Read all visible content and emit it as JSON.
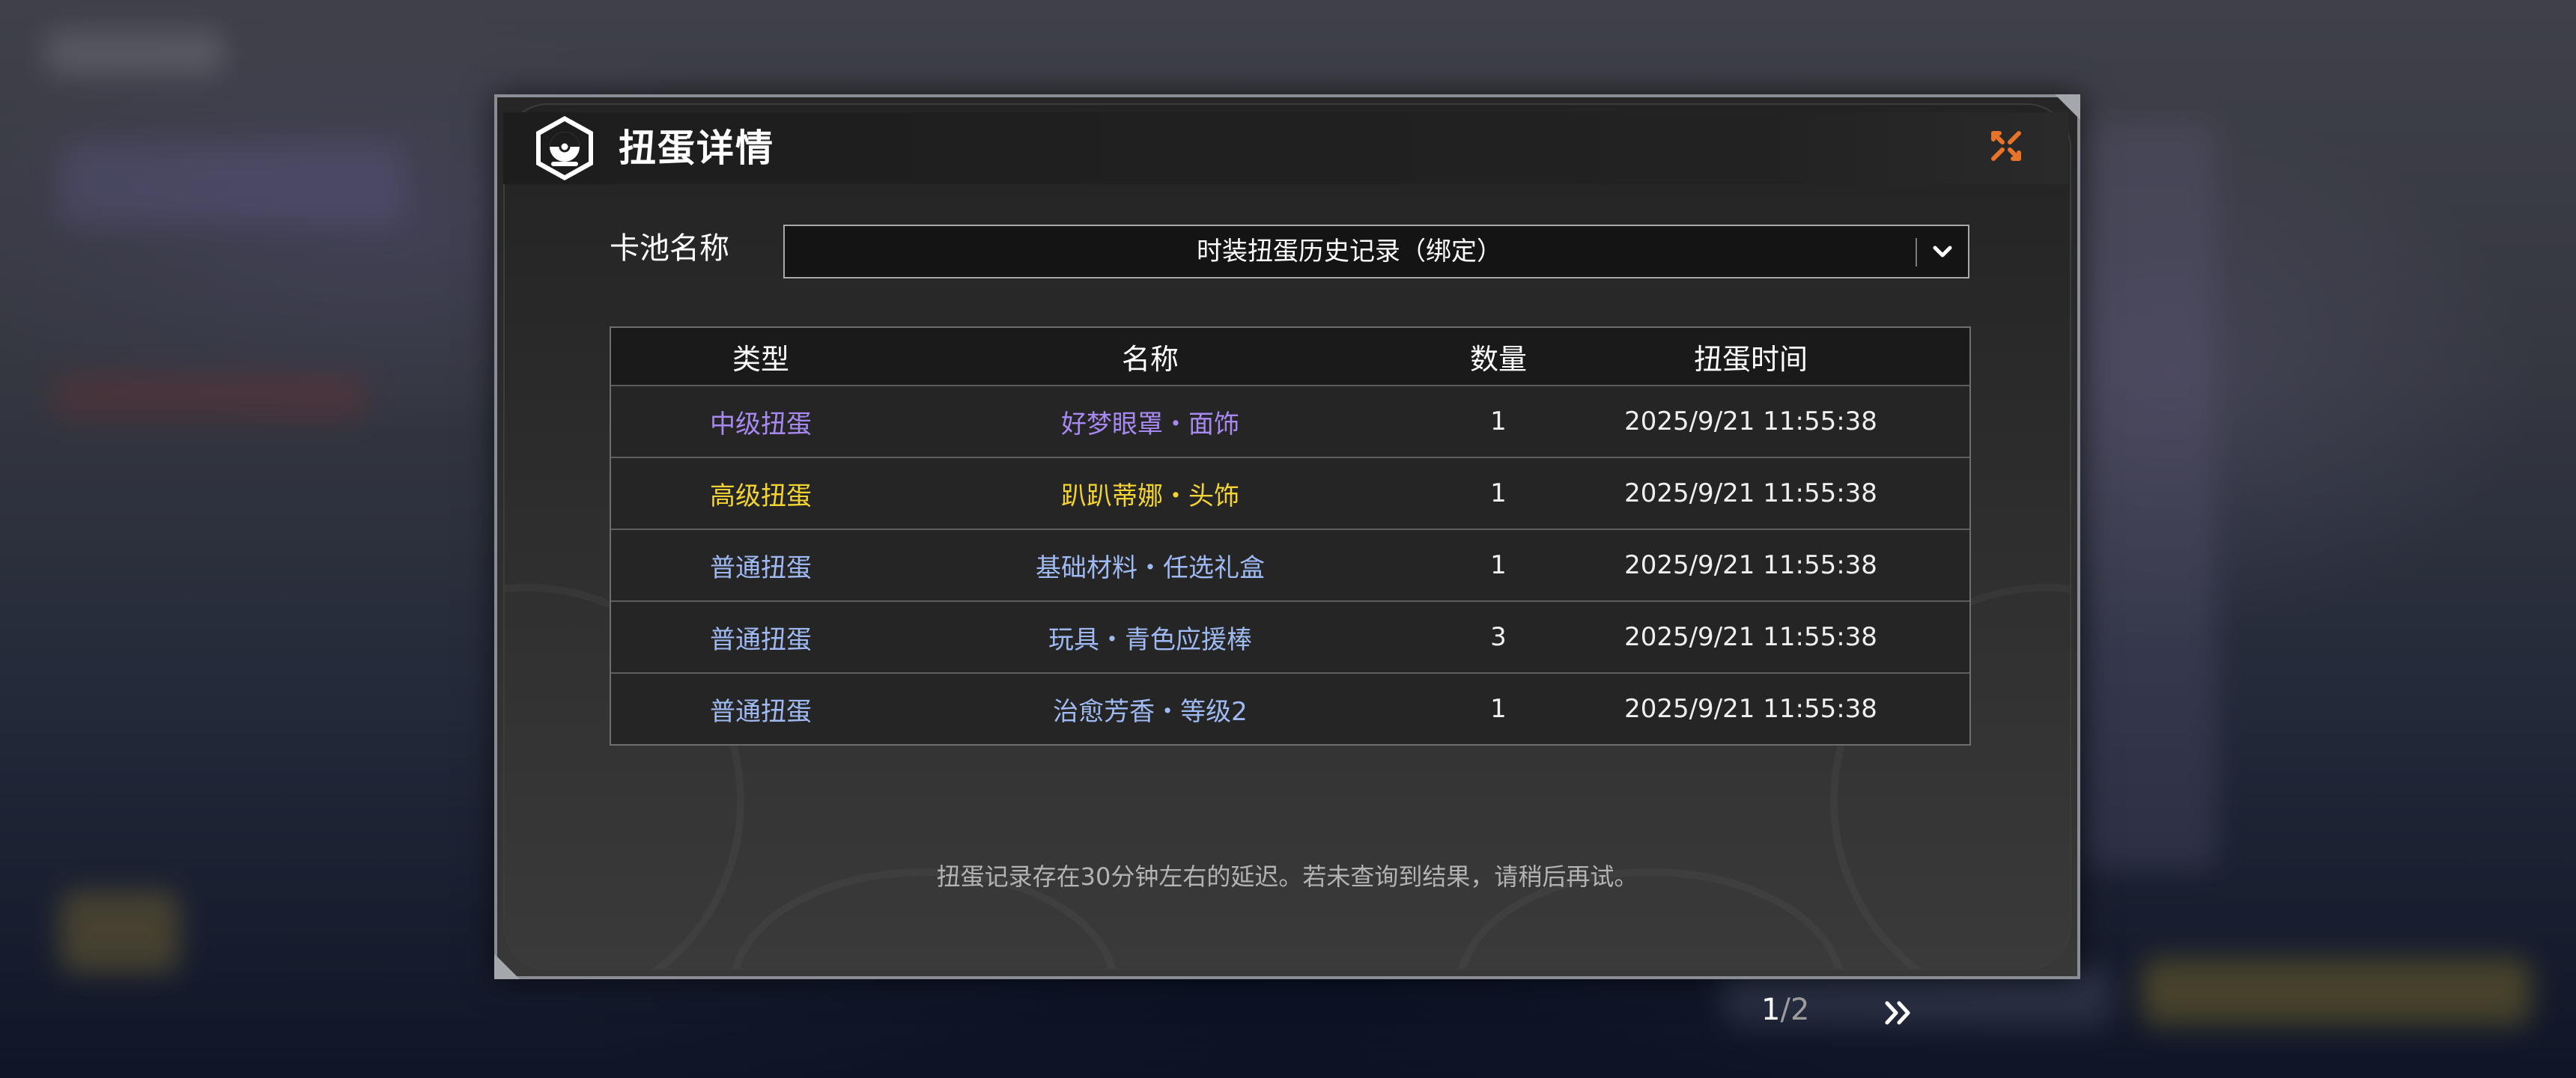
{
  "dialog": {
    "title": "扭蛋详情"
  },
  "pool": {
    "label": "卡池名称",
    "selected": "时装扭蛋历史记录（绑定）"
  },
  "table": {
    "headers": [
      "类型",
      "名称",
      "数量",
      "扭蛋时间"
    ],
    "rows": [
      {
        "type": "中级扭蛋",
        "name": "好梦眼罩・面饰",
        "qty": "1",
        "time": "2025/9/21 11:55:38",
        "color": "#a889f2"
      },
      {
        "type": "高级扭蛋",
        "name": "趴趴蒂娜・头饰",
        "qty": "1",
        "time": "2025/9/21 11:55:38",
        "color": "#f4d433"
      },
      {
        "type": "普通扭蛋",
        "name": "基础材料・任选礼盒",
        "qty": "1",
        "time": "2025/9/21 11:55:38",
        "color": "#9fbaf2"
      },
      {
        "type": "普通扭蛋",
        "name": "玩具・青色应援棒",
        "qty": "3",
        "time": "2025/9/21 11:55:38",
        "color": "#9fbaf2"
      },
      {
        "type": "普通扭蛋",
        "name": "治愈芳香・等级2",
        "qty": "1",
        "time": "2025/9/21 11:55:38",
        "color": "#9fbaf2"
      }
    ]
  },
  "notice": "扭蛋记录存在30分钟左右的延迟。若未查询到结果，请稍后再试。",
  "pagination": {
    "current": "1",
    "separator": "/",
    "total": "2"
  },
  "colors": {
    "accent_close": "#e8742a",
    "rarity_mid": "#a889f2",
    "rarity_high": "#f4d433",
    "rarity_normal": "#9fbaf2"
  },
  "icons": {
    "close": "close-x-icon",
    "dropdown": "chevron-down-icon",
    "next": "double-chevron-right-icon",
    "logo": "gacha-capsule-emblem-icon"
  }
}
